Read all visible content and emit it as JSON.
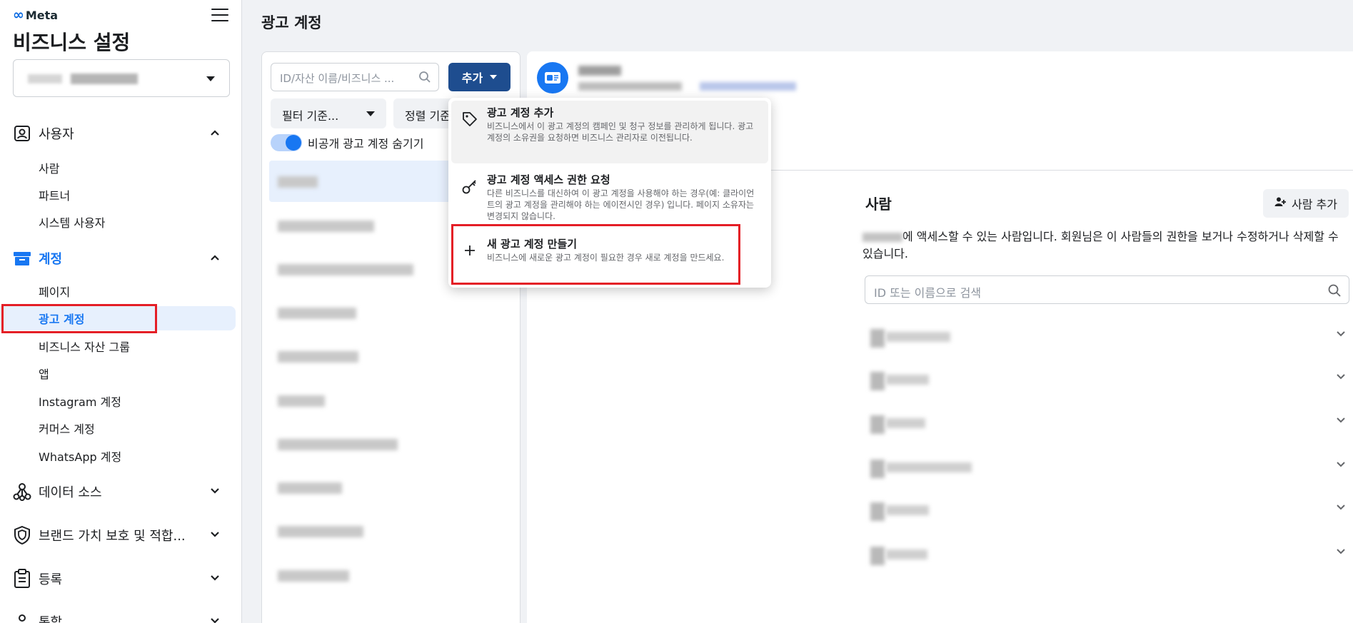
{
  "sidebar": {
    "logo_text": "Meta",
    "app_title": "비즈니스 설정",
    "sections": {
      "users": {
        "label": "사용자"
      },
      "accounts": {
        "label": "계정"
      },
      "data_sources": {
        "label": "데이터 소스"
      },
      "brand_safety": {
        "label": "브랜드 가치 보호 및 적합..."
      },
      "registrations": {
        "label": "등록"
      },
      "integrations": {
        "label": "통합"
      }
    },
    "users_items": [
      "사람",
      "파트너",
      "시스템 사용자"
    ],
    "accounts_items": [
      "페이지",
      "광고 계정",
      "비즈니스 자산 그룹",
      "앱",
      "Instagram 계정",
      "커머스 계정",
      "WhatsApp 계정"
    ],
    "selected_item": "광고 계정"
  },
  "main": {
    "page_title": "광고 계정",
    "search_placeholder": "ID/자산 이름/비즈니스 ...",
    "add_button": "추가",
    "filter_button": "필터 기준...",
    "sort_button": "정렬 기준",
    "hide_toggle_label": "비공개 광고 계정 숨기기"
  },
  "dropdown": {
    "items": [
      {
        "title": "광고 계정 추가",
        "desc": "비즈니스에서 이 광고 계정의 캠페인 및 청구 정보를 관리하게 됩니다. 광고 계정의 소유권을 요청하면 비즈니스 관리자로 이전됩니다."
      },
      {
        "title": "광고 계정 액세스 권한 요청",
        "desc": "다른 비즈니스를 대신하여 이 광고 계정을 사용해야 하는 경우(예: 클라이언트의 광고 계정을 관리해야 하는 에이전시인 경우) 입니다. 페이지 소유자는 변경되지 않습니다."
      },
      {
        "title": "새 광고 계정 만들기",
        "desc": "비즈니스에 새로운 광고 계정이 필요한 경우 새로 계정을 만드세요."
      }
    ]
  },
  "people": {
    "title": "사람",
    "add_button": "사람 추가",
    "description": "에 액세스할 수 있는 사람입니다. 회원님은 이 사람들의 권한을 보거나 수정하거나 삭제할 수 있습니다.",
    "search_placeholder": "ID 또는 이름으로 검색"
  },
  "colors": {
    "accent": "#1877f2",
    "add_button_bg": "#1e4d8f",
    "highlight_box": "#e41e26"
  }
}
